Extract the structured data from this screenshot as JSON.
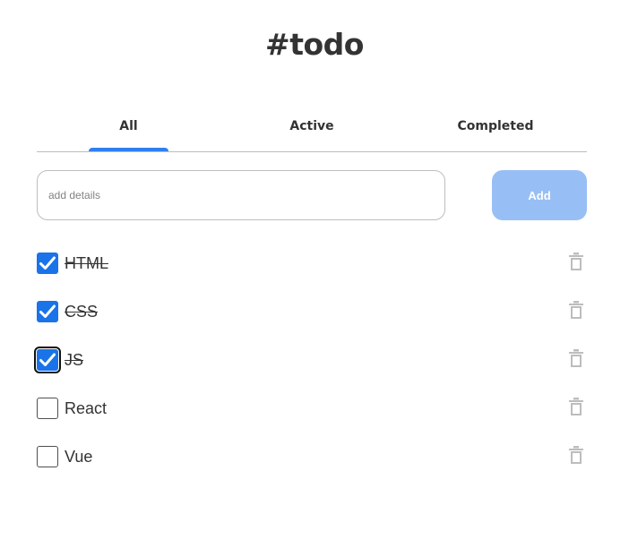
{
  "app": {
    "title": "#todo"
  },
  "tabs": [
    {
      "label": "All",
      "selected": true
    },
    {
      "label": "Active",
      "selected": false
    },
    {
      "label": "Completed",
      "selected": false
    }
  ],
  "composer": {
    "placeholder": "add details",
    "value": "",
    "add_label": "Add"
  },
  "todos": [
    {
      "text": "HTML",
      "completed": true
    },
    {
      "text": "CSS",
      "completed": true
    },
    {
      "text": "JS",
      "completed": true,
      "focused": true
    },
    {
      "text": "React",
      "completed": false
    },
    {
      "text": "Vue",
      "completed": false
    }
  ],
  "colors": {
    "accent": "#2f80ed",
    "add_button": "#98bff5",
    "checkbox_checked": "#1a73e8",
    "trash": "#bdbdbd"
  },
  "icons": {
    "check": "check-icon",
    "delete": "trash-icon"
  }
}
